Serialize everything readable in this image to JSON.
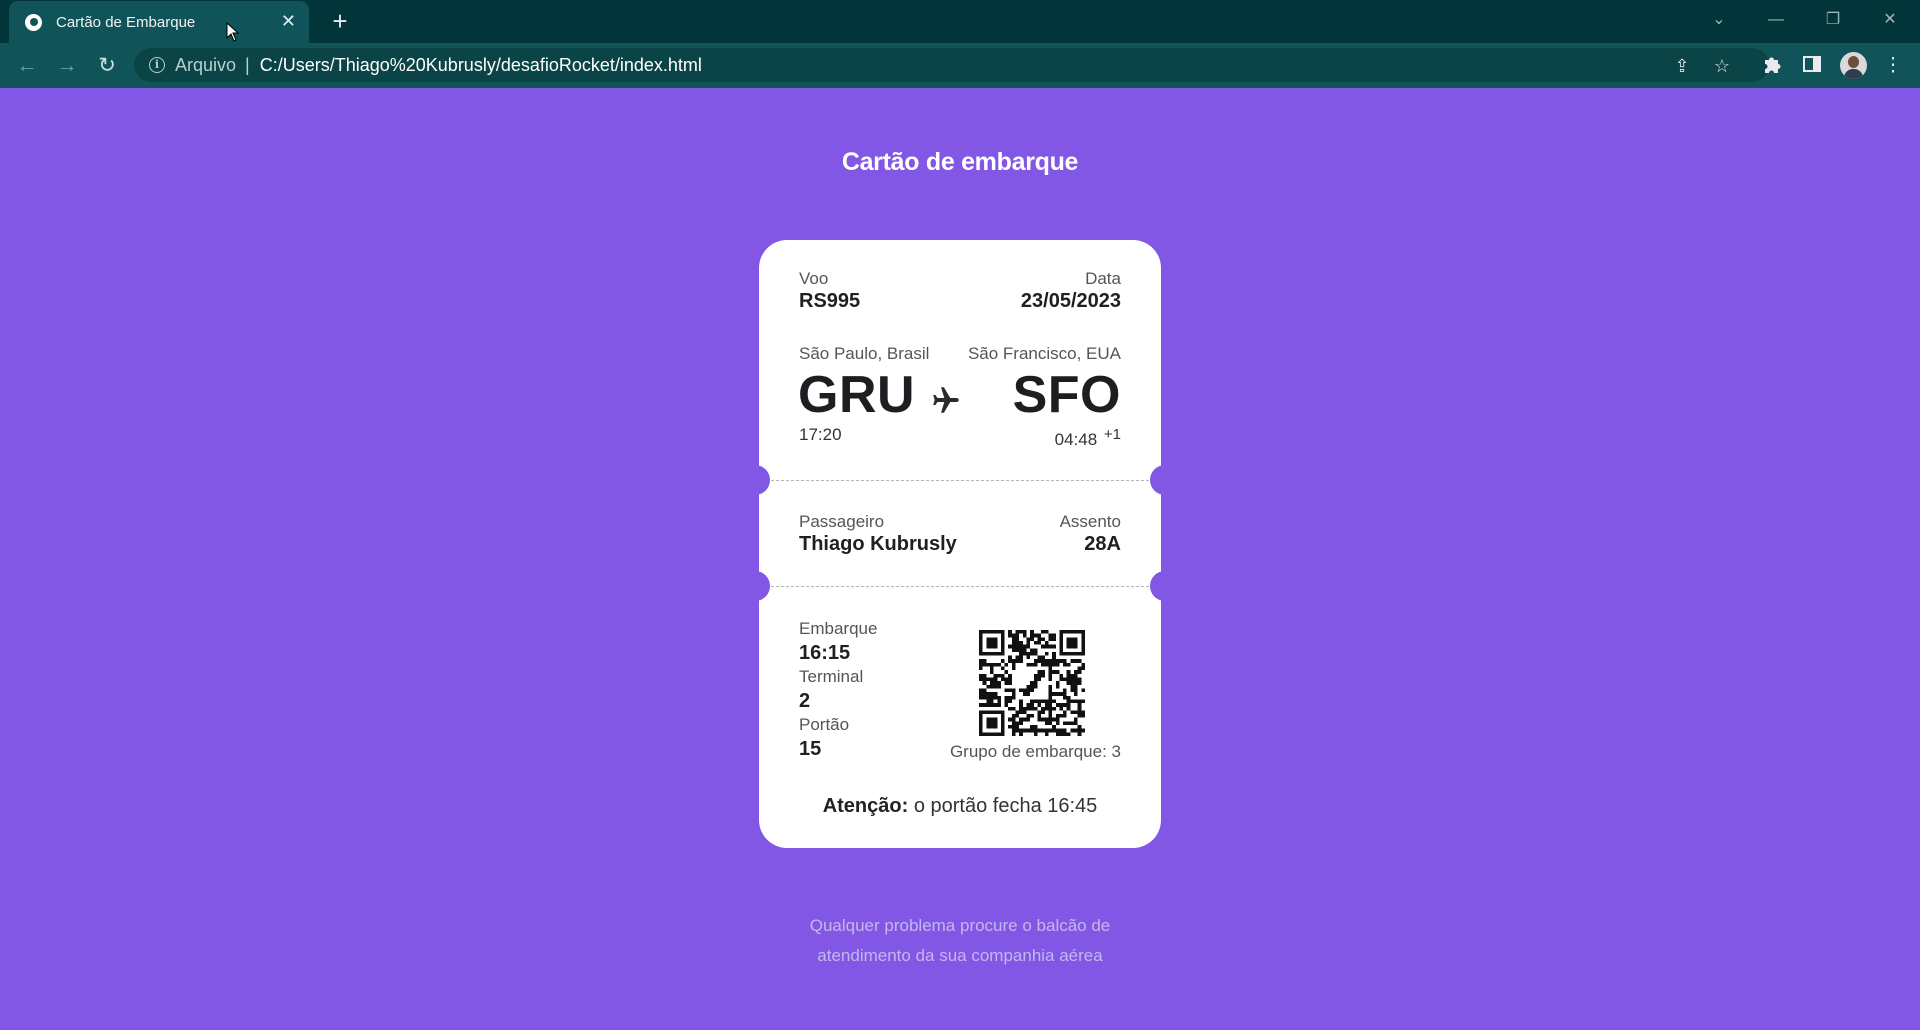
{
  "browser": {
    "tab_title": "Cartão de Embarque",
    "scheme_label": "Arquivo",
    "url": "C:/Users/Thiago%20Kubrusly/desafioRocket/index.html",
    "colors": {
      "tabstrip": "#023539",
      "toolbar": "#105459"
    }
  },
  "page": {
    "heading": "Cartão de embarque",
    "background": "#8257E5",
    "footer_line1": "Qualquer problema procure o balcão de",
    "footer_line2": "atendimento da sua companhia aérea"
  },
  "ticket": {
    "flight_label": "Voo",
    "flight_value": "RS995",
    "date_label": "Data",
    "date_value": "23/05/2023",
    "origin_city": "São Paulo, Brasil",
    "origin_code": "GRU",
    "origin_time": "17:20",
    "destination_city": "São Francisco, EUA",
    "destination_code": "SFO",
    "destination_time": "04:48",
    "destination_day_offset": "+1",
    "passenger_label": "Passageiro",
    "passenger_value": "Thiago Kubrusly",
    "seat_label": "Assento",
    "seat_value": "28A",
    "boarding_label": "Embarque",
    "boarding_value": "16:15",
    "terminal_label": "Terminal",
    "terminal_value": "2",
    "gate_label": "Portão",
    "gate_value": "15",
    "group_text": "Grupo de embarque: 3",
    "attention_bold": "Atenção:",
    "attention_text": " o portão fecha 16:45"
  },
  "icons": [
    "globe-icon",
    "close-icon",
    "plus-icon",
    "back-arrow-icon",
    "forward-arrow-icon",
    "reload-icon",
    "info-icon",
    "share-icon",
    "star-icon",
    "puzzle-icon",
    "side-panel-icon",
    "avatar",
    "airplane-icon",
    "qr-code"
  ]
}
